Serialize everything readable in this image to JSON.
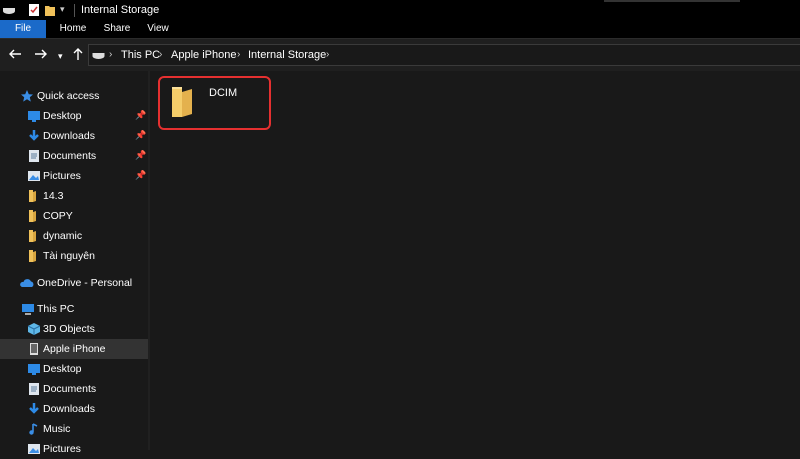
{
  "window": {
    "title": "Internal Storage"
  },
  "ribbon": {
    "tabs": [
      "File",
      "Home",
      "Share",
      "View"
    ]
  },
  "nav": {
    "breadcrumb": [
      "This PC",
      "Apple iPhone",
      "Internal Storage"
    ]
  },
  "sidebar": {
    "quick_access": "Quick access",
    "quick_items": [
      {
        "label": "Desktop",
        "icon": "desktop-icon",
        "pinned": true
      },
      {
        "label": "Downloads",
        "icon": "downloads-icon",
        "pinned": true
      },
      {
        "label": "Documents",
        "icon": "documents-icon",
        "pinned": true
      },
      {
        "label": "Pictures",
        "icon": "pictures-icon",
        "pinned": true
      },
      {
        "label": "14.3",
        "icon": "folder-icon",
        "pinned": false
      },
      {
        "label": "COPY",
        "icon": "folder-icon",
        "pinned": false
      },
      {
        "label": "dynamic",
        "icon": "folder-icon",
        "pinned": false
      },
      {
        "label": "Tài nguyên",
        "icon": "folder-icon",
        "pinned": false
      }
    ],
    "onedrive": "OneDrive - Personal",
    "this_pc": "This PC",
    "pc_items": [
      {
        "label": "3D Objects",
        "icon": "3d-objects-icon"
      },
      {
        "label": "Apple iPhone",
        "icon": "iphone-icon",
        "selected": true
      },
      {
        "label": "Desktop",
        "icon": "desktop-icon"
      },
      {
        "label": "Documents",
        "icon": "documents-icon"
      },
      {
        "label": "Downloads",
        "icon": "downloads-icon"
      },
      {
        "label": "Music",
        "icon": "music-icon"
      },
      {
        "label": "Pictures",
        "icon": "pictures-icon"
      }
    ]
  },
  "content": {
    "folders": [
      {
        "name": "DCIM",
        "icon": "folder-icon",
        "highlighted": true
      }
    ]
  },
  "colors": {
    "accent": "#1b6ac9",
    "highlight_border": "#e53030",
    "folder": "#f0c15a"
  }
}
